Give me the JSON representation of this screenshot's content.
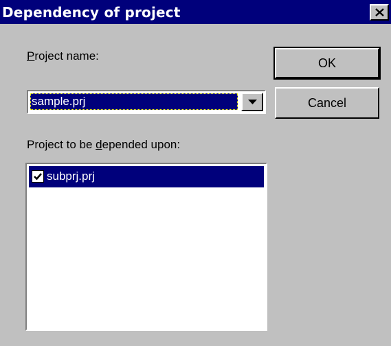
{
  "window": {
    "title": "Dependency of project"
  },
  "title_bar": {
    "close_icon": "close-icon"
  },
  "project_name": {
    "label_mnemonic": "P",
    "label_rest": "roject name:",
    "selected_value": "sample.prj"
  },
  "depends": {
    "label_before": "Project to be ",
    "label_mnemonic": "d",
    "label_after": "epended upon:",
    "items": [
      {
        "label": "subprj.prj",
        "checked": true,
        "selected": true
      }
    ]
  },
  "buttons": {
    "ok": "OK",
    "cancel": "Cancel"
  },
  "colors": {
    "face": "#c0c0c0",
    "title_bar": "#00007b",
    "selection": "#00007b"
  }
}
